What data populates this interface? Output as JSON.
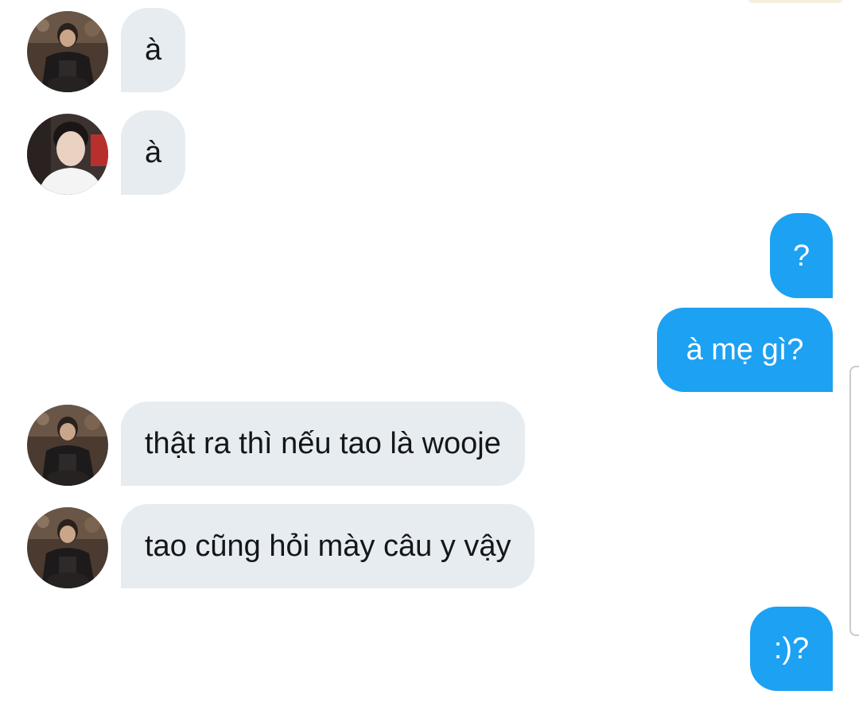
{
  "messages": [
    {
      "side": "incoming",
      "avatar": "avatar-dark-jacket",
      "text": "à"
    },
    {
      "side": "incoming",
      "avatar": "avatar-white-shirt",
      "text": "à"
    },
    {
      "side": "outgoing",
      "text": "?"
    },
    {
      "side": "outgoing",
      "text": "à mẹ gì?"
    },
    {
      "side": "incoming",
      "avatar": "avatar-dark-jacket",
      "text": "thật ra thì nếu tao là wooje"
    },
    {
      "side": "incoming",
      "avatar": "avatar-dark-jacket",
      "text": "tao cũng hỏi mày câu y vậy"
    },
    {
      "side": "outgoing",
      "text": ":)?"
    }
  ],
  "colors": {
    "incoming_bubble": "#e6ecf0",
    "outgoing_bubble": "#1da1f2",
    "incoming_text": "#14171a",
    "outgoing_text": "#ffffff"
  }
}
